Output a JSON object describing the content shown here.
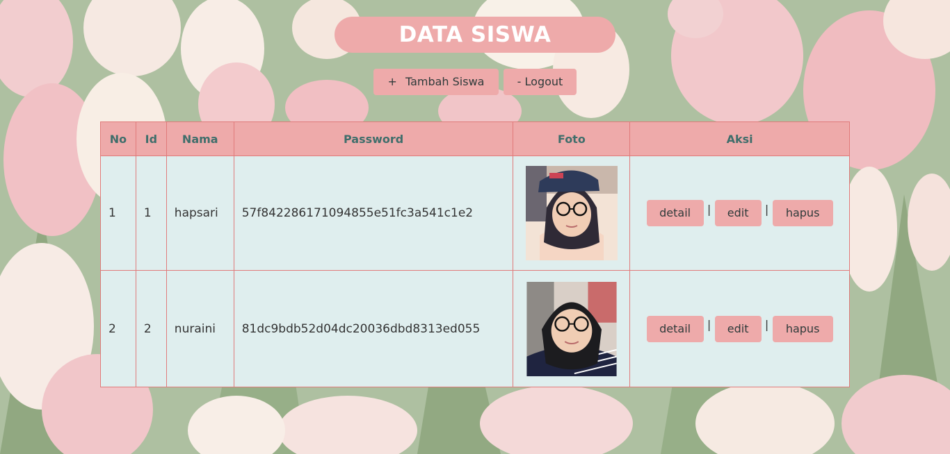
{
  "header": {
    "title": "DATA SISWA",
    "add_label": "Tambah Siswa",
    "add_prefix": "+",
    "logout_label": "- Logout"
  },
  "table": {
    "columns": [
      "No",
      "Id",
      "Nama",
      "Password",
      "Foto",
      "Aksi"
    ],
    "rows": [
      {
        "no": "1",
        "id": "1",
        "nama": "hapsari",
        "password": "57f842286171094855e51fc3a541c1e2",
        "actions": {
          "detail": "detail",
          "edit": "edit",
          "hapus": "hapus"
        }
      },
      {
        "no": "2",
        "id": "2",
        "nama": "nuraini",
        "password": "81dc9bdb52d04dc20036dbd8313ed055",
        "actions": {
          "detail": "detail",
          "edit": "edit",
          "hapus": "hapus"
        }
      }
    ],
    "separator": "|"
  },
  "colors": {
    "accent": "#eeaaaa",
    "header_text": "#3f6e6b",
    "cell_bg": "#dfeeee",
    "border": "#e07a7a"
  }
}
